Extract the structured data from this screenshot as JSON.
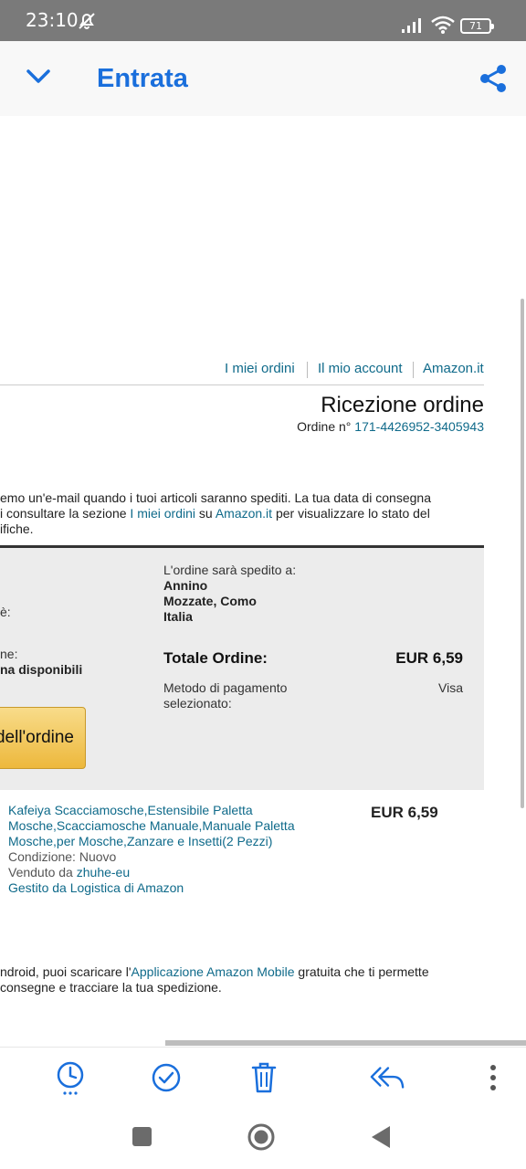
{
  "status_bar": {
    "time": "23:10",
    "battery": "71"
  },
  "app_bar": {
    "title": "Entrata"
  },
  "email": {
    "top_links": {
      "my_orders": "I miei ordini",
      "my_account": "Il mio account",
      "amazon": "Amazon.it",
      "separator": "|"
    },
    "heading": "Ricezione ordine",
    "order_label": "Ordine n°",
    "order_number": "171-4426952-3405943",
    "intro": {
      "line1": "emo un'e-mail quando i tuoi articoli saranno spediti. La tua data di consegna",
      "line2_a": "i consultare la sezione ",
      "line2_link1": "I miei ordini",
      "line2_b": " su ",
      "line2_link2": "Amazon.it",
      "line2_c": " per visualizzare lo stato del",
      "line3": "ifiche."
    },
    "summary": {
      "left_label1": "è:",
      "left_label2": "ne:",
      "left_value2": "na disponibili",
      "ship_label": "L'ordine sarà spedito a:",
      "ship_name": "Annino",
      "ship_city": "Mozzate, Como",
      "ship_country": "Italia",
      "total_label": "Totale Ordine:",
      "total_value": "EUR 6,59",
      "payment_label_1": "Metodo di pagamento",
      "payment_label_2": "selezionato:",
      "payment_value": "Visa",
      "details_button": "dell'ordine"
    },
    "item": {
      "title_1": "Kafeiya Scacciamosche,Estensibile Paletta",
      "title_2": "Mosche,Scacciamosche Manuale,Manuale Paletta",
      "title_3": "Mosche,per Mosche,Zanzare e Insetti(2 Pezzi)",
      "condition": "Condizione: Nuovo",
      "sold_by_label": "Venduto da ",
      "sold_by": "zhuhe-eu",
      "fulfilled": "Gestito da Logistica di Amazon",
      "price": "EUR 6,59"
    },
    "footer": {
      "line1_a": "ndroid, puoi scaricare l'",
      "line1_link": "Applicazione Amazon Mobile",
      "line1_b": " gratuita che ti permette",
      "line2": "consegne e tracciare la tua spedizione."
    }
  },
  "toolbar": {
    "icons": [
      "snooze-icon",
      "mark-done-icon",
      "delete-icon",
      "reply-all-icon",
      "more-icon"
    ]
  },
  "colors": {
    "accent": "#1a6fdc",
    "link": "#0f6a8a",
    "status_bar": "#7a7a7a",
    "button": "#edb83c"
  }
}
